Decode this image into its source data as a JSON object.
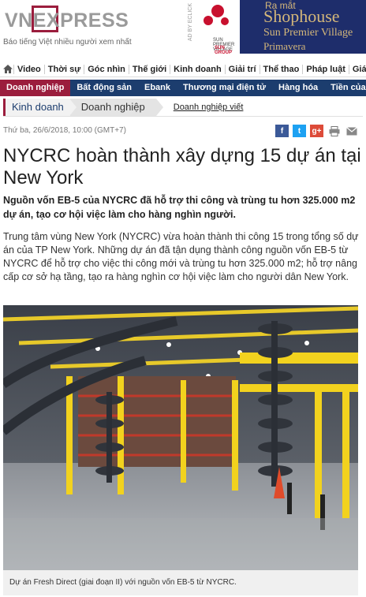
{
  "header": {
    "logo_text": "VNEXPRESS",
    "tagline": "Báo tiếng Việt nhiều người xem nhất",
    "ad": {
      "vertical_label": "AD BY ECLICK",
      "line1": "Ra mắt",
      "line2": "Shophouse",
      "line3": "Sun Premier Village",
      "line4": "Primavera",
      "small1": "SUN PREMIER VILLAGE",
      "small2": "SUN GROUP"
    }
  },
  "topnav": [
    "Video",
    "Thời sự",
    "Góc nhìn",
    "Thế giới",
    "Kinh doanh",
    "Giải trí",
    "Thể thao",
    "Pháp luật",
    "Giáo dục"
  ],
  "subnav": [
    "Doanh nghiệp",
    "Bất động sản",
    "Ebank",
    "Thương mại điện tử",
    "Hàng hóa",
    "Tiền của"
  ],
  "breadcrumb": {
    "section": "Kinh doanh",
    "subsection": "Doanh nghiệp",
    "link": "Doanh nghiệp viết"
  },
  "article": {
    "date": "Thứ ba, 26/6/2018, 10:00 (GMT+7)",
    "title": "NYCRC hoàn thành xây dựng 15 dự án tại New York",
    "lead": "Nguồn vốn EB-5 của NYCRC đã hỗ trợ thi công và trùng tu hơn 325.000 m2 dự án, tạo cơ hội việc làm cho hàng nghìn người.",
    "body": "Trung tâm vùng New York (NYCRC) vừa hoàn thành thi công 15 trong tổng số dự án của TP New York. Những dự án đã tận dụng thành công nguồn vốn EB-5 từ NYCRC để hỗ trợ cho việc thi công mới và trùng tu hơn 325.000 m2; hỗ trợ nâng cấp cơ sở hạ tầng, tạo ra hàng nghìn cơ hội việc làm cho người dân New York.",
    "caption": "Dự án Fresh Direct (giai đoạn II) với nguồn vốn EB-5 từ NYCRC."
  },
  "share": {
    "facebook": "f",
    "twitter": "t",
    "googleplus": "g+"
  },
  "colors": {
    "brand": "#9b1d3d",
    "nav": "#1c3d6e",
    "facebook": "#3b5998",
    "twitter": "#1da1f2",
    "googleplus": "#dd4b39"
  }
}
